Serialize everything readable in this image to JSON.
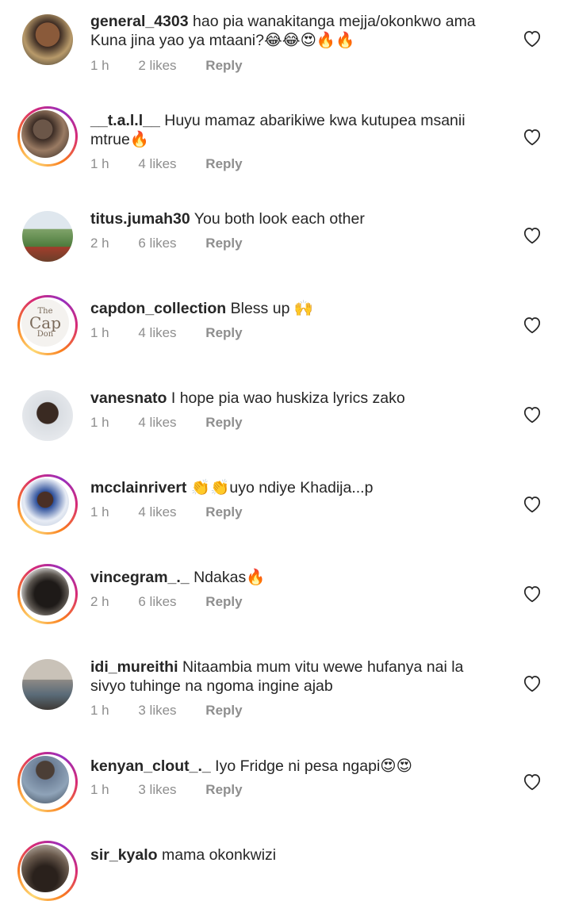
{
  "comments": [
    {
      "username": "general_4303",
      "text": "hao pia wanakitanga mejja/okonkwo ama Kuna jina yao ya mtaani?",
      "emojis": [
        "laugh",
        "laugh",
        "hearteyes",
        "fire",
        "fire"
      ],
      "time": "1 h",
      "likes": "2 likes",
      "reply": "Reply"
    },
    {
      "username": "__t.a.l.l__",
      "text": "Huyu mamaz abarikiwe kwa kutupea msanii mtrue",
      "emojis": [
        "fire"
      ],
      "time": "1 h",
      "likes": "4 likes",
      "reply": "Reply"
    },
    {
      "username": "titus.jumah30",
      "text": "You both look each other",
      "emojis": [],
      "time": "2 h",
      "likes": "6 likes",
      "reply": "Reply"
    },
    {
      "username": "capdon_collection",
      "text": "Bless up",
      "emojis": [
        "pray"
      ],
      "time": "1 h",
      "likes": "4 likes",
      "reply": "Reply",
      "avatar_text": [
        "The",
        "Cap",
        "Don"
      ]
    },
    {
      "username": "vanesnato",
      "text": "I hope pia wao huskiza lyrics zako",
      "emojis": [],
      "time": "1 h",
      "likes": "4 likes",
      "reply": "Reply"
    },
    {
      "username": "mcclainrivert",
      "text": "uyo ndiye Khadija...p",
      "emojis_before": [
        "clap",
        "clap"
      ],
      "emojis": [],
      "time": "1 h",
      "likes": "4 likes",
      "reply": "Reply"
    },
    {
      "username": "vincegram_._",
      "text": "Ndakas",
      "emojis": [
        "fire"
      ],
      "time": "2 h",
      "likes": "6 likes",
      "reply": "Reply"
    },
    {
      "username": "idi_mureithi",
      "text": "Nitaambia mum vitu wewe hufanya nai la sivyo tuhinge na ngoma ingine ajab",
      "emojis": [],
      "time": "1 h",
      "likes": "3 likes",
      "reply": "Reply"
    },
    {
      "username": "kenyan_clout_._",
      "text": "Iyo Fridge ni pesa ngapi",
      "emojis": [
        "hearteyes",
        "hearteyes"
      ],
      "time": "1 h",
      "likes": "3 likes",
      "reply": "Reply"
    },
    {
      "username": "sir_kyalo",
      "text": "mama okonkwizi",
      "emojis": [],
      "time": "",
      "likes": "",
      "reply": ""
    }
  ],
  "icons": {
    "like": "heart-outline-icon"
  },
  "colors": {
    "text": "#262626",
    "meta": "#8e8e8e",
    "story_ring": "#d62976"
  }
}
